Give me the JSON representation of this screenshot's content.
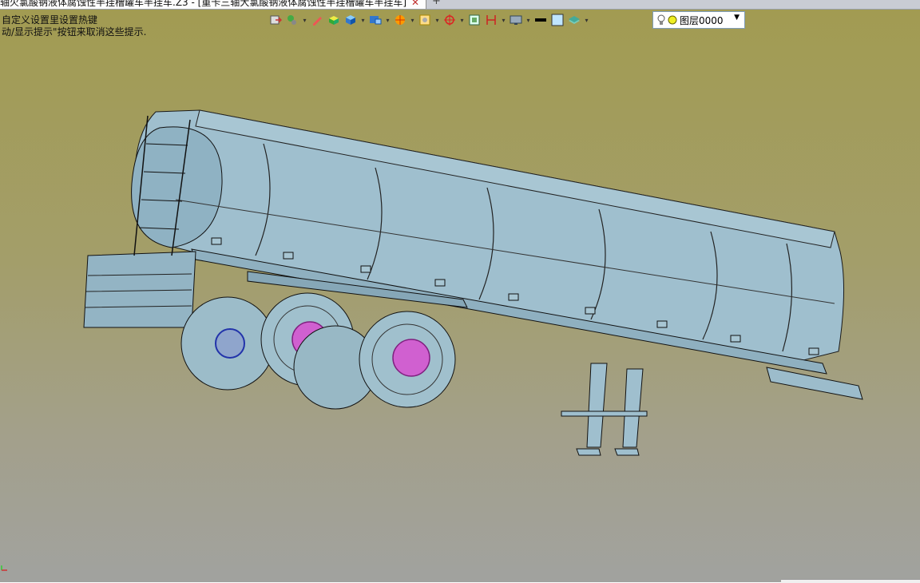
{
  "tab": {
    "title": "轴火氯酸钠液体腐蚀性半挂槽罐车半挂车.Z3 - [重卡三轴大氯酸钠液体腐蚀性半挂槽罐车半挂车]"
  },
  "hints": {
    "line1": "自定义设置里设置热键",
    "line2": "动/显示提示\"按钮来取消这些提示."
  },
  "toolbar": {
    "icons": [
      "exit-icon",
      "node-icon",
      "pencil-icon",
      "box-icon",
      "cube-icon",
      "view-icon",
      "render-icon",
      "sheet-icon",
      "target-icon",
      "frame-icon",
      "cut-icon",
      "monitor-icon",
      "line-color-icon",
      "fill-color-icon",
      "layer-stack-icon"
    ]
  },
  "layer": {
    "value": "图层0000"
  },
  "colors": {
    "background_top": "#a29b51",
    "background_bottom": "#a1a29f",
    "model_fill": "#9fbfce",
    "hub_color": "#d060d0"
  }
}
